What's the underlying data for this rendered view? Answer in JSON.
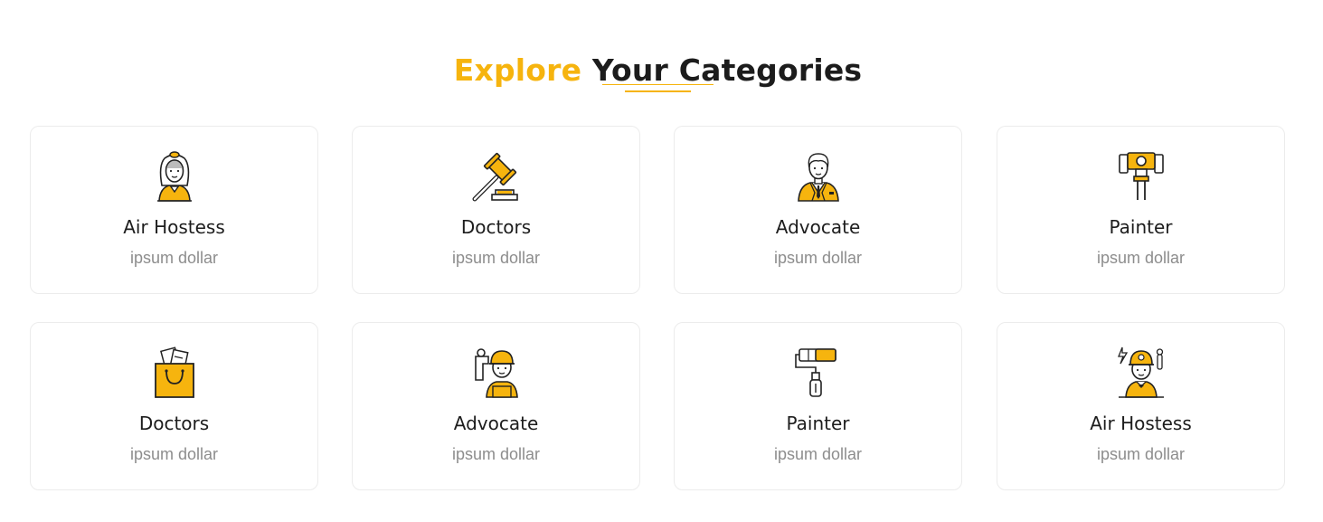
{
  "section": {
    "title_accent": "Explore",
    "title_rest": " Your Categories"
  },
  "colors": {
    "accent": "#f6b40e",
    "text": "#1d1d1d",
    "muted": "#8d8d8d",
    "border": "#ececec"
  },
  "categories": [
    {
      "title": "Air Hostess",
      "subtitle": "ipsum dollar",
      "icon": "air-hostess-icon"
    },
    {
      "title": "Doctors",
      "subtitle": "ipsum dollar",
      "icon": "gavel-icon"
    },
    {
      "title": "Advocate",
      "subtitle": "ipsum dollar",
      "icon": "businessman-icon"
    },
    {
      "title": "Painter",
      "subtitle": "ipsum dollar",
      "icon": "pipe-wrench-icon"
    },
    {
      "title": "Doctors",
      "subtitle": "ipsum dollar",
      "icon": "shopping-bag-icon"
    },
    {
      "title": "Advocate",
      "subtitle": "ipsum dollar",
      "icon": "plumber-icon"
    },
    {
      "title": "Painter",
      "subtitle": "ipsum dollar",
      "icon": "paint-roller-icon"
    },
    {
      "title": "Air Hostess",
      "subtitle": "ipsum dollar",
      "icon": "engineer-icon"
    }
  ]
}
